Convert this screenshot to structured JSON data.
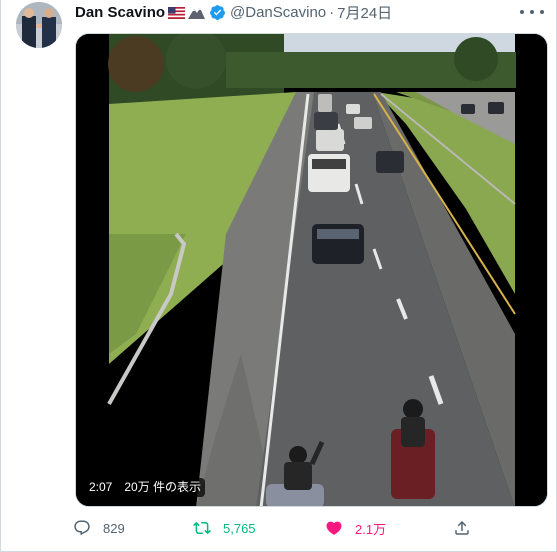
{
  "tweet": {
    "author_name": "Dan Scavino",
    "handle": "@DanScavino",
    "separator": "·",
    "date": "7月24日",
    "icons": {
      "flag": "us-flag-icon",
      "mountain": "mountain-icon",
      "verified": "verified-badge-icon",
      "more": "more-icon"
    }
  },
  "media": {
    "duration": "2:07",
    "views": "20万 件の表示"
  },
  "actions": {
    "reply_count": "829",
    "retweet_count": "5,765",
    "like_count": "2.1万",
    "share_label": ""
  },
  "colors": {
    "text_primary": "#0f1419",
    "text_secondary": "#536471",
    "verified_blue": "#1d9bf0",
    "retweet_green": "#00ba7c",
    "like_pink": "#f91880"
  }
}
